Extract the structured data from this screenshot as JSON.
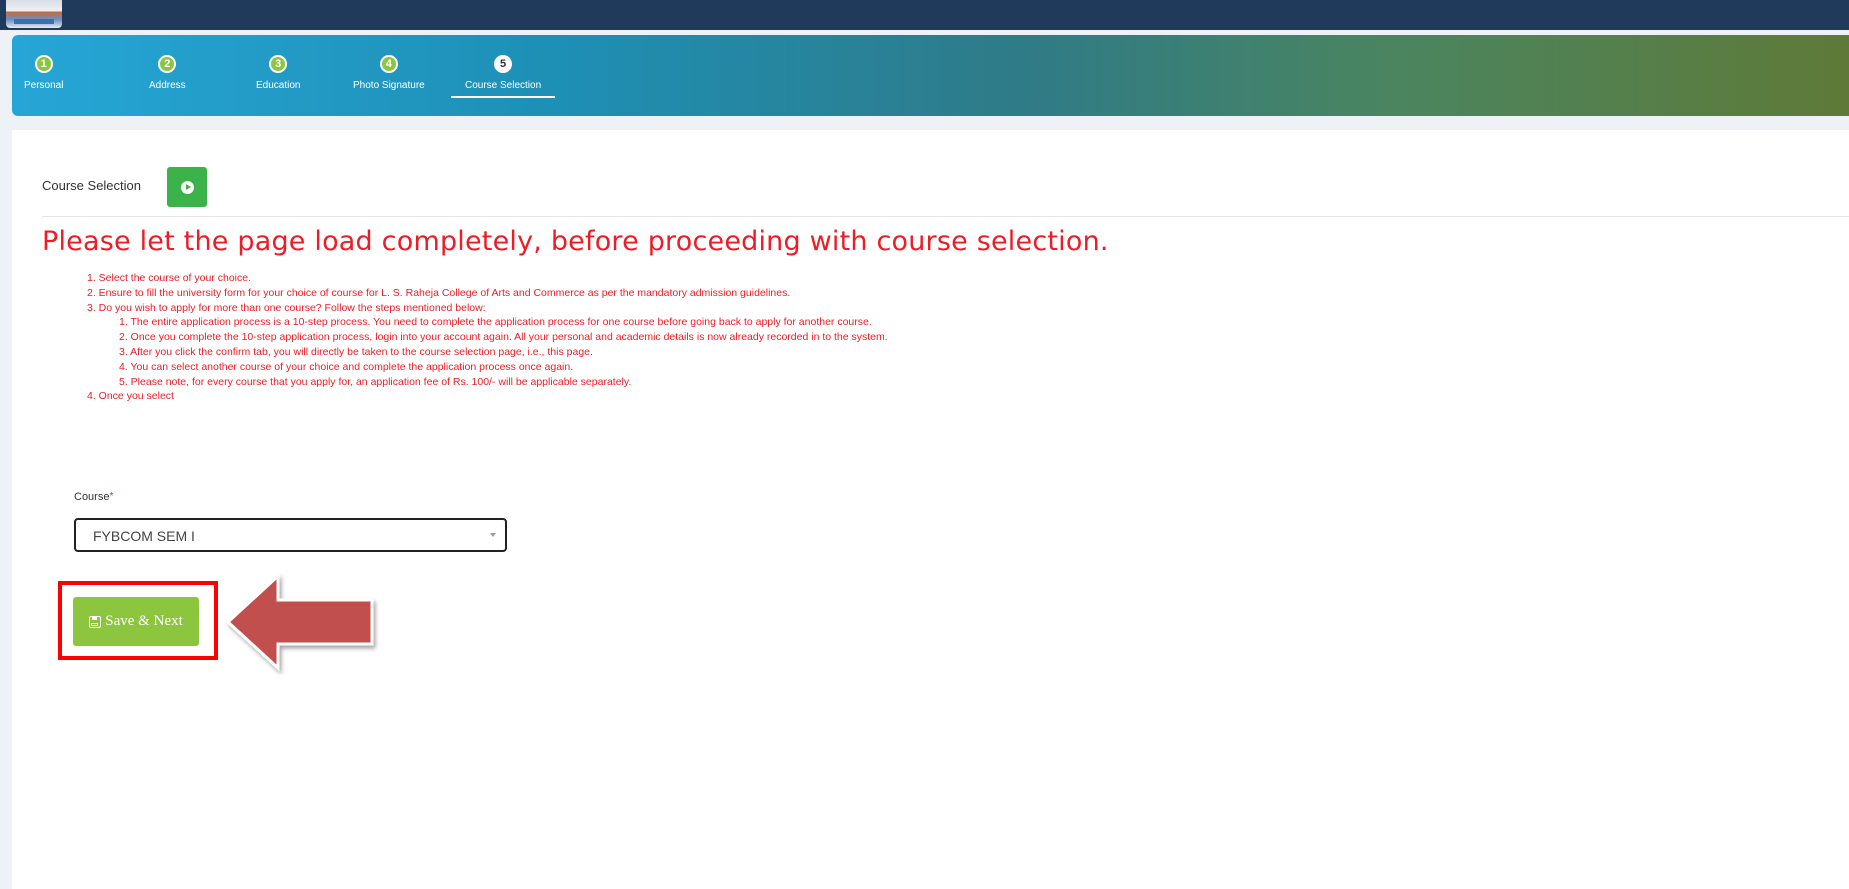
{
  "steps": [
    {
      "num": "1",
      "label": "Personal"
    },
    {
      "num": "2",
      "label": "Address"
    },
    {
      "num": "3",
      "label": "Education"
    },
    {
      "num": "4",
      "label": "Photo Signature"
    },
    {
      "num": "5",
      "label": "Course Selection"
    }
  ],
  "section": {
    "title": "Course Selection",
    "play_icon": "play-circle-icon"
  },
  "warning": "Please let the page load completely, before proceeding with course selection.",
  "instructions": {
    "i1": "1. Select the course of your choice.",
    "i2": "2. Ensure to fill the university form for your choice of course for L. S. Raheja College of Arts and Commerce as per the mandatory admission guidelines.",
    "i3": "3. Do you wish to apply for more than one course? Follow the steps mentioned below:",
    "s1": "1. The entire application process is a 10-step process. You need to complete the application process for one course before going back to apply for another course.",
    "s2": "2. Once you complete the 10-step application process, login into your account again. All your personal and academic details is now already recorded in to the system.",
    "s3": "3. After you click the confirm tab, you will directly be taken to the course selection page, i.e., this page.",
    "s4": "4. You can select another course of your choice and complete the application process once again.",
    "s5": "5. Please note, for every course that you apply for, an application fee of Rs. 100/- will be applicable separately.",
    "i4": "4. Once you select"
  },
  "form": {
    "course_label": "Course",
    "required_mark": "*",
    "course_value": "FYBCOM SEM I"
  },
  "save_button": {
    "label": "Save & Next",
    "icon": "floppy-disk-icon"
  },
  "colors": {
    "header": "#1f3a5a",
    "warning_red": "#ee1c25",
    "button_green": "#8cc63f",
    "play_green": "#3bb34a",
    "arrow": "#c0504d"
  }
}
